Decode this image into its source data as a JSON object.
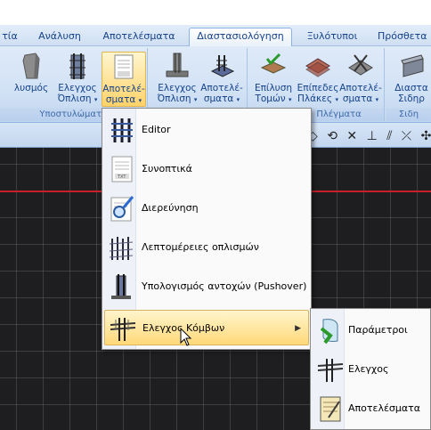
{
  "tabs": [
    {
      "label": "τία",
      "active": false
    },
    {
      "label": "Ανάλυση",
      "active": false
    },
    {
      "label": "Αποτελέσματα",
      "active": false
    },
    {
      "label": "Διαστασιολόγηση",
      "active": true
    },
    {
      "label": "Ξυλότυποι",
      "active": false
    },
    {
      "label": "Πρόσθετα",
      "active": false
    }
  ],
  "ribbon": {
    "groups": [
      {
        "label": "Υποστυλώματα"
      },
      {
        "label": "Πλέγματα"
      },
      {
        "label": "Σιδη"
      }
    ],
    "buttons": [
      {
        "line1": "λυσμός",
        "line2": "",
        "icon": "column-solid-icon"
      },
      {
        "line1": "Ελεγχος",
        "line2": "Όπλιση",
        "icon": "column-rebar-icon"
      },
      {
        "line1": "Αποτελέ-",
        "line2": "σματα",
        "icon": "results-sheet-icon"
      },
      {
        "line1": "Ελεγχος",
        "line2": "Όπλιση",
        "icon": "beam-column-icon"
      },
      {
        "line1": "Αποτελέ-",
        "line2": "σματα",
        "icon": "foundation-icon"
      },
      {
        "line1": "Επίλυση",
        "line2": "Τομών",
        "icon": "section-check-icon"
      },
      {
        "line1": "Επίπεδες",
        "line2": "Πλάκες",
        "icon": "slab-icon"
      },
      {
        "line1": "Αποτελέ-",
        "line2": "σματα",
        "icon": "slab-results-icon"
      },
      {
        "line1": "Διαστα",
        "line2": "Σιδηρ",
        "icon": "steel-beam-icon"
      }
    ]
  },
  "menu": {
    "items": [
      {
        "label": "Editor",
        "icon": "rebar-cage-icon",
        "submenu": false
      },
      {
        "label": "Συνοπτικά",
        "icon": "txt-document-icon",
        "submenu": false
      },
      {
        "label": "Διερεύνηση",
        "icon": "investigation-icon",
        "submenu": false
      },
      {
        "label": "Λεπτομέρειες οπλισμών",
        "icon": "reinforcement-details-icon",
        "submenu": false
      },
      {
        "label": "Υπολογισμός αντοχών (Pushover)",
        "icon": "pushover-icon",
        "submenu": false
      },
      {
        "label": "Ελεγχος Κόμβων",
        "icon": "joint-check-icon",
        "submenu": true,
        "highlighted": true
      }
    ]
  },
  "submenu": {
    "items": [
      {
        "label": "Παράμετροι",
        "icon": "parameters-icon"
      },
      {
        "label": "Ελεγχος",
        "icon": "joint-check-icon"
      },
      {
        "label": "Αποτελέσματα",
        "icon": "results-notepad-icon"
      }
    ]
  },
  "colors": {
    "accent": "#15428b",
    "highlight": "#ffd97a",
    "canvas": "#1e1e20",
    "redline": "#c8202a"
  }
}
